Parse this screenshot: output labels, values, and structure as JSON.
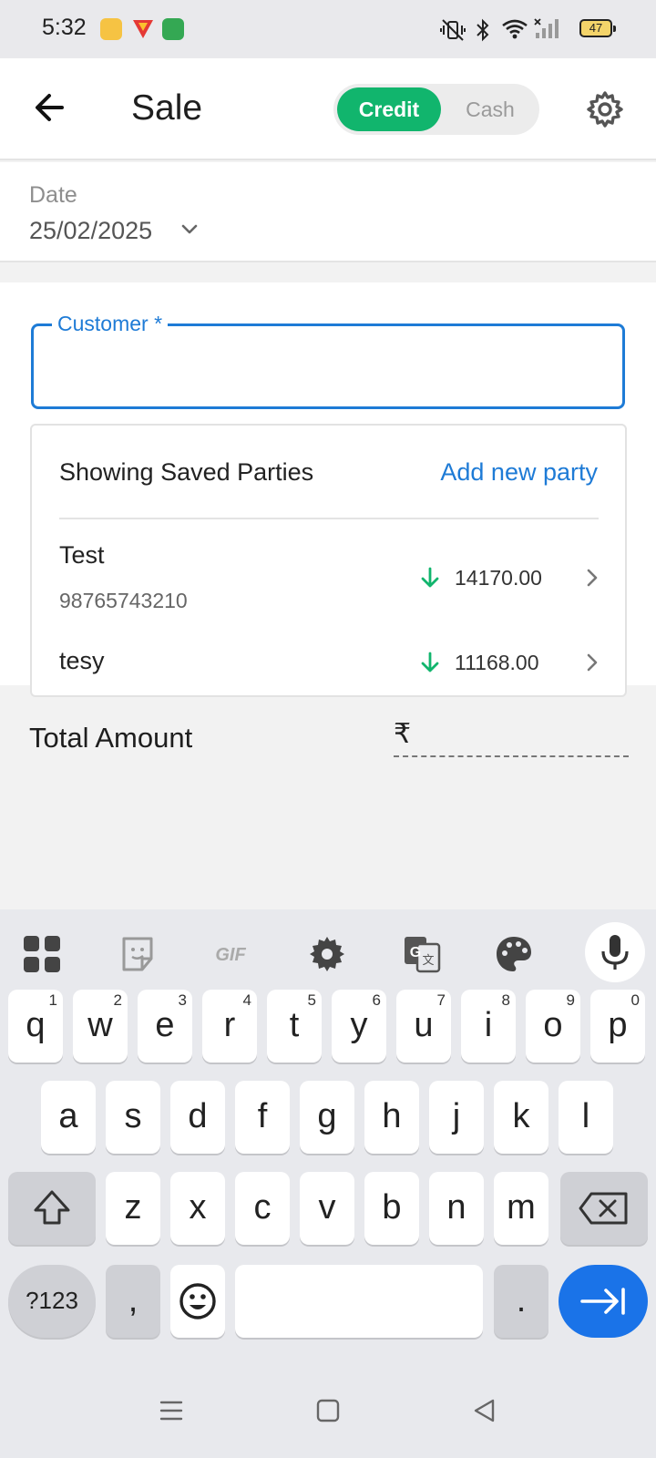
{
  "status": {
    "time": "5:32",
    "battery": "47"
  },
  "header": {
    "title": "Sale",
    "toggle": {
      "credit": "Credit",
      "cash": "Cash",
      "selected": "Credit"
    }
  },
  "date": {
    "label": "Date",
    "value": "25/02/2025"
  },
  "customer": {
    "label": "Customer *",
    "value": ""
  },
  "parties": {
    "heading": "Showing Saved Parties",
    "add_label": "Add new party",
    "items": [
      {
        "name": "Test",
        "phone": "98765743210",
        "amount": "14170.00"
      },
      {
        "name": "tesy",
        "phone": "",
        "amount": "11168.00"
      }
    ]
  },
  "total": {
    "label": "Total Amount",
    "currency": "₹",
    "value": ""
  },
  "keyboard": {
    "toolbar": [
      "apps-grid-icon",
      "sticker-icon",
      "gif-icon",
      "settings-icon",
      "translate-icon",
      "palette-icon",
      "mic-icon"
    ],
    "row1": [
      {
        "k": "q",
        "n": "1"
      },
      {
        "k": "w",
        "n": "2"
      },
      {
        "k": "e",
        "n": "3"
      },
      {
        "k": "r",
        "n": "4"
      },
      {
        "k": "t",
        "n": "5"
      },
      {
        "k": "y",
        "n": "6"
      },
      {
        "k": "u",
        "n": "7"
      },
      {
        "k": "i",
        "n": "8"
      },
      {
        "k": "o",
        "n": "9"
      },
      {
        "k": "p",
        "n": "0"
      }
    ],
    "row2": [
      "a",
      "s",
      "d",
      "f",
      "g",
      "h",
      "j",
      "k",
      "l"
    ],
    "row3": [
      "z",
      "x",
      "c",
      "v",
      "b",
      "n",
      "m"
    ],
    "symbols_label": "?123",
    "comma": ",",
    "period": "."
  },
  "colors": {
    "accent_green": "#11b56d",
    "accent_blue": "#1e7bd6",
    "enter_blue": "#1a73e8"
  }
}
